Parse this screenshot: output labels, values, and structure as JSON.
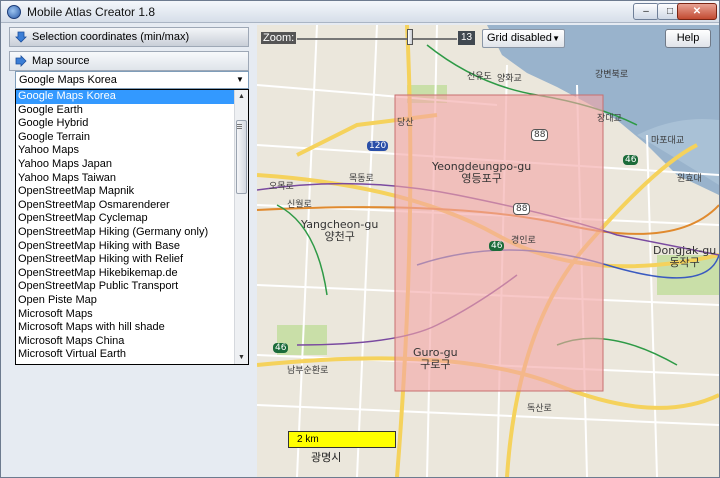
{
  "window": {
    "title": "Mobile Atlas Creator 1.8",
    "buttons": {
      "minimize": "–",
      "maximize": "□",
      "close": "✕"
    }
  },
  "left_panel": {
    "selection_header": "Selection coordinates (min/max)",
    "map_source_header": "Map source",
    "map_source_selected": "Google Maps Korea",
    "map_sources": [
      "Google Maps Korea",
      "Google Earth",
      "Google Hybrid",
      "Google Terrain",
      "Yahoo Maps",
      "Yahoo Maps Japan",
      "Yahoo Maps Taiwan",
      "OpenStreetMap Mapnik",
      "OpenStreetMap Osmarenderer",
      "OpenStreetMap Cyclemap",
      "OpenStreetMap Hiking (Germany only)",
      "OpenStreetMap Hiking with Base",
      "OpenStreetMap Hiking with Relief",
      "OpenStreetMap Hikebikemap.de",
      "OpenStreetMap Public Transport",
      "Open Piste Map",
      "Microsoft Maps",
      "Microsoft Maps with hill shade",
      "Microsoft Maps China",
      "Microsoft Virtual Earth"
    ]
  },
  "map": {
    "zoom_label": "Zoom:",
    "zoom_value": "13",
    "grid_option": "Grid disabled",
    "help_label": "Help",
    "scale_label": "2 km",
    "labels": {
      "seonyudo": "선유도",
      "yanghwa": "양화교",
      "gangbyeon": "강변북로",
      "dangsan": "당산",
      "yeongdeungpo_en": "Yeongdeungpo-gu",
      "yeongdeungpo_ko": "영등포구",
      "yangcheon_en": "Yangcheon-gu",
      "yangcheon_ko": "양천구",
      "guro_en": "Guro-gu",
      "guro_ko": "구로구",
      "dongjak_en": "Dongjak-gu",
      "dongjak_ko": "동작구",
      "mapo": "마포대교",
      "wonhyo": "원효대",
      "mokdong": "목동로",
      "ohmokro": "오목로",
      "sinwolro": "신월로",
      "gyeongin": "경인로",
      "nambu": "남부순환로",
      "gwangmyeong": "광명시",
      "doksan": "독산로",
      "jangdae": "장대교",
      "shield_88a": "88",
      "shield_88b": "88",
      "shield_46a": "46",
      "shield_46b": "46",
      "shield_46c": "46",
      "shield_120": "120"
    }
  },
  "colors": {
    "selection_fill": "#f4a6a6",
    "river": "#99b3cc",
    "road_major": "#f5d25c",
    "road_minor": "#ffffff",
    "park": "#c9dfa8"
  }
}
